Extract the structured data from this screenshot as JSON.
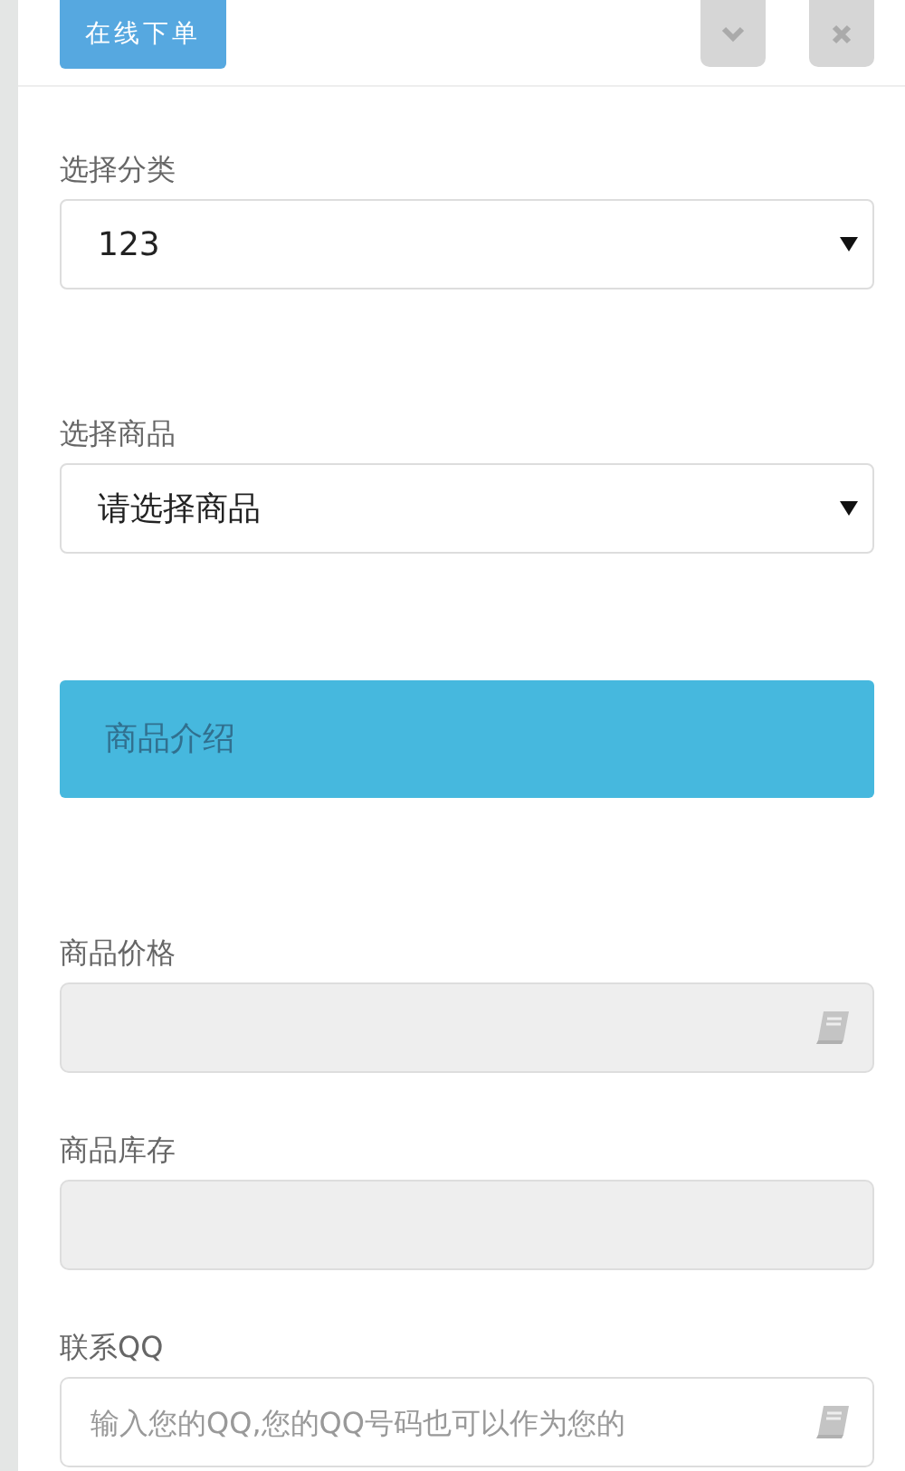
{
  "header": {
    "title_button": "在线下单",
    "tool_buttons": [
      {
        "kind": "collapse"
      },
      {
        "kind": "close"
      }
    ]
  },
  "fields": [
    {
      "kind": "select",
      "label": "选择分类",
      "value": "123"
    },
    {
      "kind": "select",
      "label": "选择商品",
      "value": "请选择商品"
    },
    {
      "kind": "banner",
      "text": "商品介绍"
    },
    {
      "kind": "input",
      "label": "商品价格",
      "disabled": true,
      "addon_icon": true
    },
    {
      "kind": "input",
      "label": "商品库存",
      "disabled": true,
      "addon_icon": false
    },
    {
      "kind": "input",
      "label": "联系QQ",
      "disabled": false,
      "addon_icon": true,
      "placeholder": "输入您的QQ,您的QQ号码也可以作为您的"
    }
  ]
}
